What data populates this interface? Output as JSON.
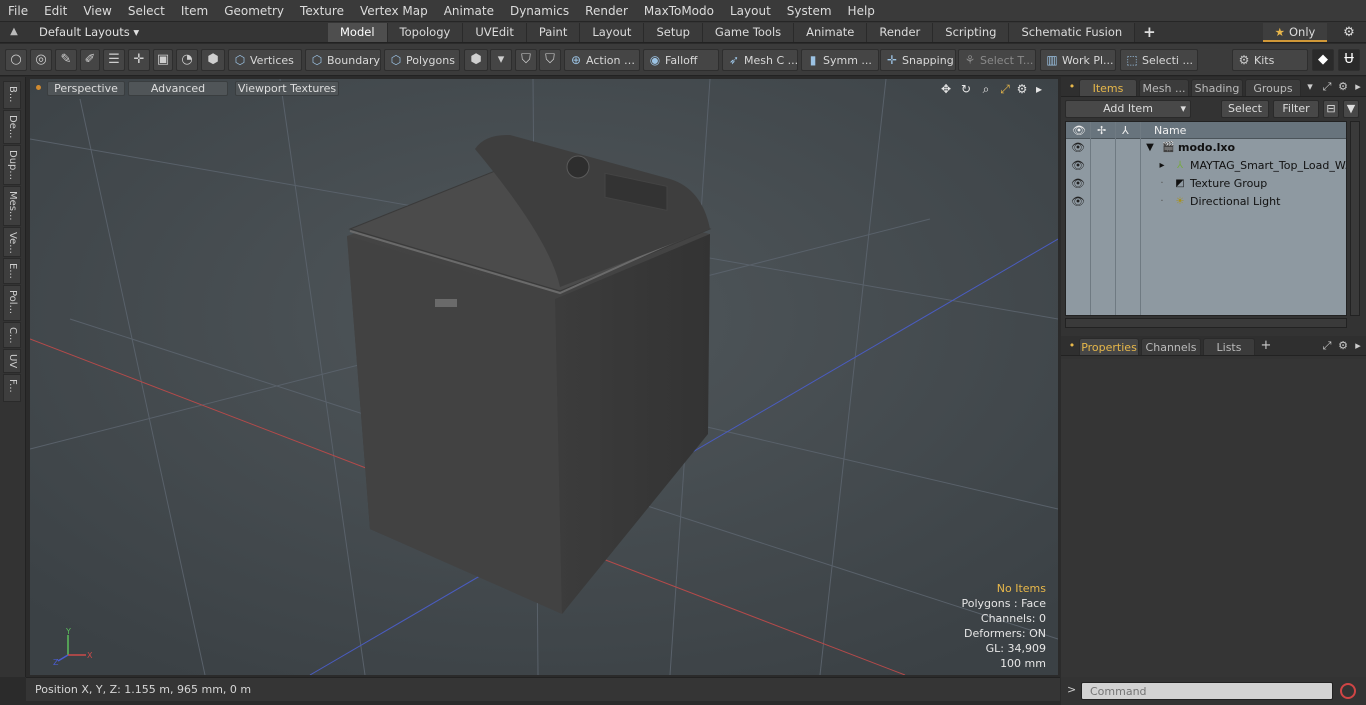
{
  "menu": [
    "File",
    "Edit",
    "View",
    "Select",
    "Item",
    "Geometry",
    "Texture",
    "Vertex Map",
    "Animate",
    "Dynamics",
    "Render",
    "MaxToModo",
    "Layout",
    "System",
    "Help"
  ],
  "layoutbar": {
    "layouts_label": "Default Layouts ▾",
    "tabs": [
      "Model",
      "Topology",
      "UVEdit",
      "Paint",
      "Layout",
      "Setup",
      "Game Tools",
      "Animate",
      "Render",
      "Scripting",
      "Schematic Fusion"
    ],
    "active_tab": "Model",
    "plus": "+",
    "only_label": "Only"
  },
  "toolbar": {
    "vertices": "Vertices",
    "boundary": "Boundary",
    "polygons": "Polygons",
    "action": "Action",
    "falloff": "Falloff",
    "mesh_c": "Mesh C ...",
    "symm": "Symm ...",
    "snapping": "Snapping",
    "select_t": "Select T...",
    "work_pl": "Work Pl...",
    "selecti": "Selecti ...",
    "kits": "Kits"
  },
  "lefttabs": [
    "B...",
    "De...",
    "Dup...",
    "Mes...",
    "Ve...",
    "E...",
    "Pol...",
    "C...",
    "UV",
    "F..."
  ],
  "viewport": {
    "perspective": "Perspective",
    "advanced": "Advanced",
    "viewport_textures": "Viewport Textures",
    "stats": {
      "no_items": "No Items",
      "polygons": "Polygons : Face",
      "channels": "Channels: 0",
      "deformers": "Deformers: ON",
      "gl": "GL: 34,909",
      "scale": "100 mm"
    },
    "axis": {
      "y": "Y",
      "x": "X",
      "z": "Z"
    }
  },
  "status": {
    "position": "Position X, Y, Z:   1.155 m, 965 mm, 0 m"
  },
  "items_panel": {
    "tabs": [
      "Items",
      "Mesh ...",
      "Shading",
      "Groups"
    ],
    "add_item": "Add Item",
    "select": "Select",
    "filter": "Filter",
    "column_name": "Name",
    "rows": [
      {
        "label": "modo.lxo",
        "bold": true
      },
      {
        "label": "MAYTAG_Smart_Top_Load_W..."
      },
      {
        "label": "Texture Group"
      },
      {
        "label": "Directional Light"
      }
    ]
  },
  "props_panel": {
    "tabs": [
      "Properties",
      "Channels",
      "Lists"
    ],
    "plus": "+"
  },
  "command": {
    "placeholder": "Command",
    "arrow": ">"
  },
  "colors": {
    "accent": "#e8b84a",
    "viewport_bg": "#464c50",
    "tree_bg": "#8e99a1"
  }
}
